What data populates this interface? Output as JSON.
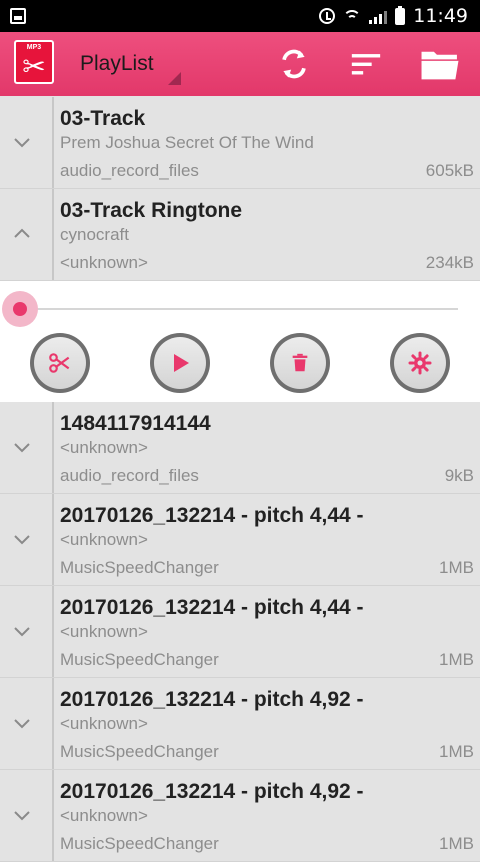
{
  "status_bar": {
    "time": "11:49"
  },
  "app_bar": {
    "title": "PlayList",
    "logo_text": "MP3"
  },
  "colors": {
    "accent": "#e9386c",
    "app_bar": "#e8426f",
    "row_bg": "#e3e3e3"
  },
  "tracks": [
    {
      "title": "03-Track",
      "artist": "Prem Joshua Secret Of The Wind",
      "folder": "audio_record_files",
      "size": "605kB",
      "expanded": false
    },
    {
      "title": "03-Track Ringtone",
      "artist": "cynocraft",
      "folder": "<unknown>",
      "size": "234kB",
      "expanded": true
    },
    {
      "title": "1484117914144",
      "artist": "<unknown>",
      "folder": "audio_record_files",
      "size": "9kB",
      "expanded": false
    },
    {
      "title": "20170126_132214 - pitch 4,44 -",
      "artist": "<unknown>",
      "folder": "MusicSpeedChanger",
      "size": "1MB",
      "expanded": false
    },
    {
      "title": "20170126_132214 - pitch 4,44 -",
      "artist": "<unknown>",
      "folder": "MusicSpeedChanger",
      "size": "1MB",
      "expanded": false
    },
    {
      "title": "20170126_132214 - pitch 4,92 -",
      "artist": "<unknown>",
      "folder": "MusicSpeedChanger",
      "size": "1MB",
      "expanded": false
    },
    {
      "title": "20170126_132214 - pitch 4,92 -",
      "artist": "<unknown>",
      "folder": "MusicSpeedChanger",
      "size": "1MB",
      "expanded": false
    }
  ],
  "player": {
    "progress": 0,
    "controls": [
      "cut-icon",
      "play-icon",
      "trash-icon",
      "settings-icon"
    ]
  }
}
